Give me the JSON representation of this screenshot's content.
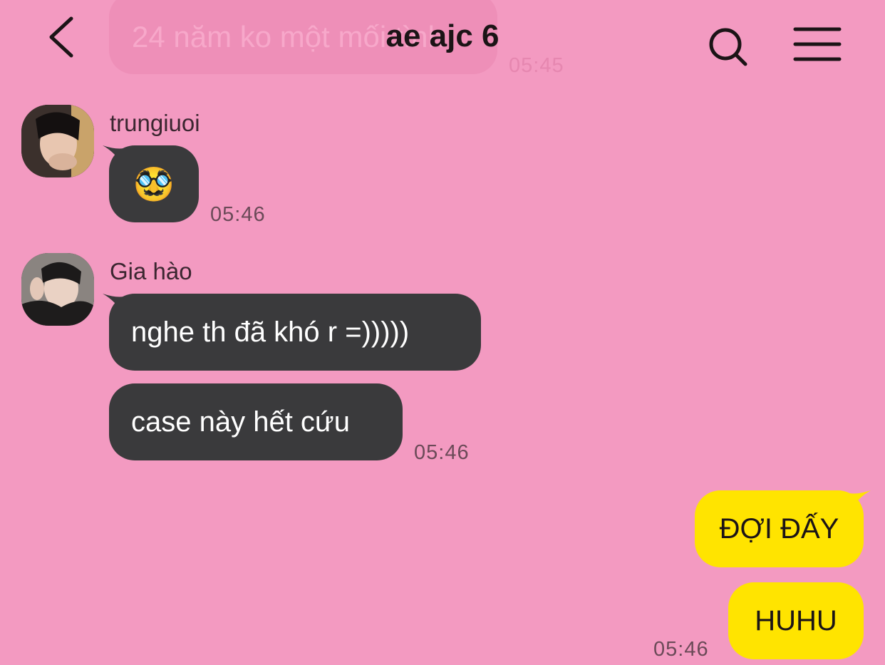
{
  "header": {
    "title": "ae ajc 6"
  },
  "previous_message": {
    "text": "24 năm ko một mối tình",
    "time": "05:45"
  },
  "messages": [
    {
      "sender": "trungiuoi",
      "bubbles": [
        "🥸"
      ],
      "time": "05:46"
    },
    {
      "sender": "Gia hào",
      "bubbles": [
        "nghe th đã khó r =)))))",
        "case này hết cứu"
      ],
      "time": "05:46"
    }
  ],
  "own_messages": {
    "bubbles": [
      "ĐỢI ĐẤY",
      "HUHU"
    ],
    "time": "05:46"
  },
  "colors": {
    "background": "#F39AC1",
    "incoming_bubble": "#3A3A3C",
    "outgoing_bubble": "#FFE400"
  },
  "icons": [
    "back-chevron-icon",
    "search-icon",
    "menu-icon",
    "avatar-photo"
  ]
}
